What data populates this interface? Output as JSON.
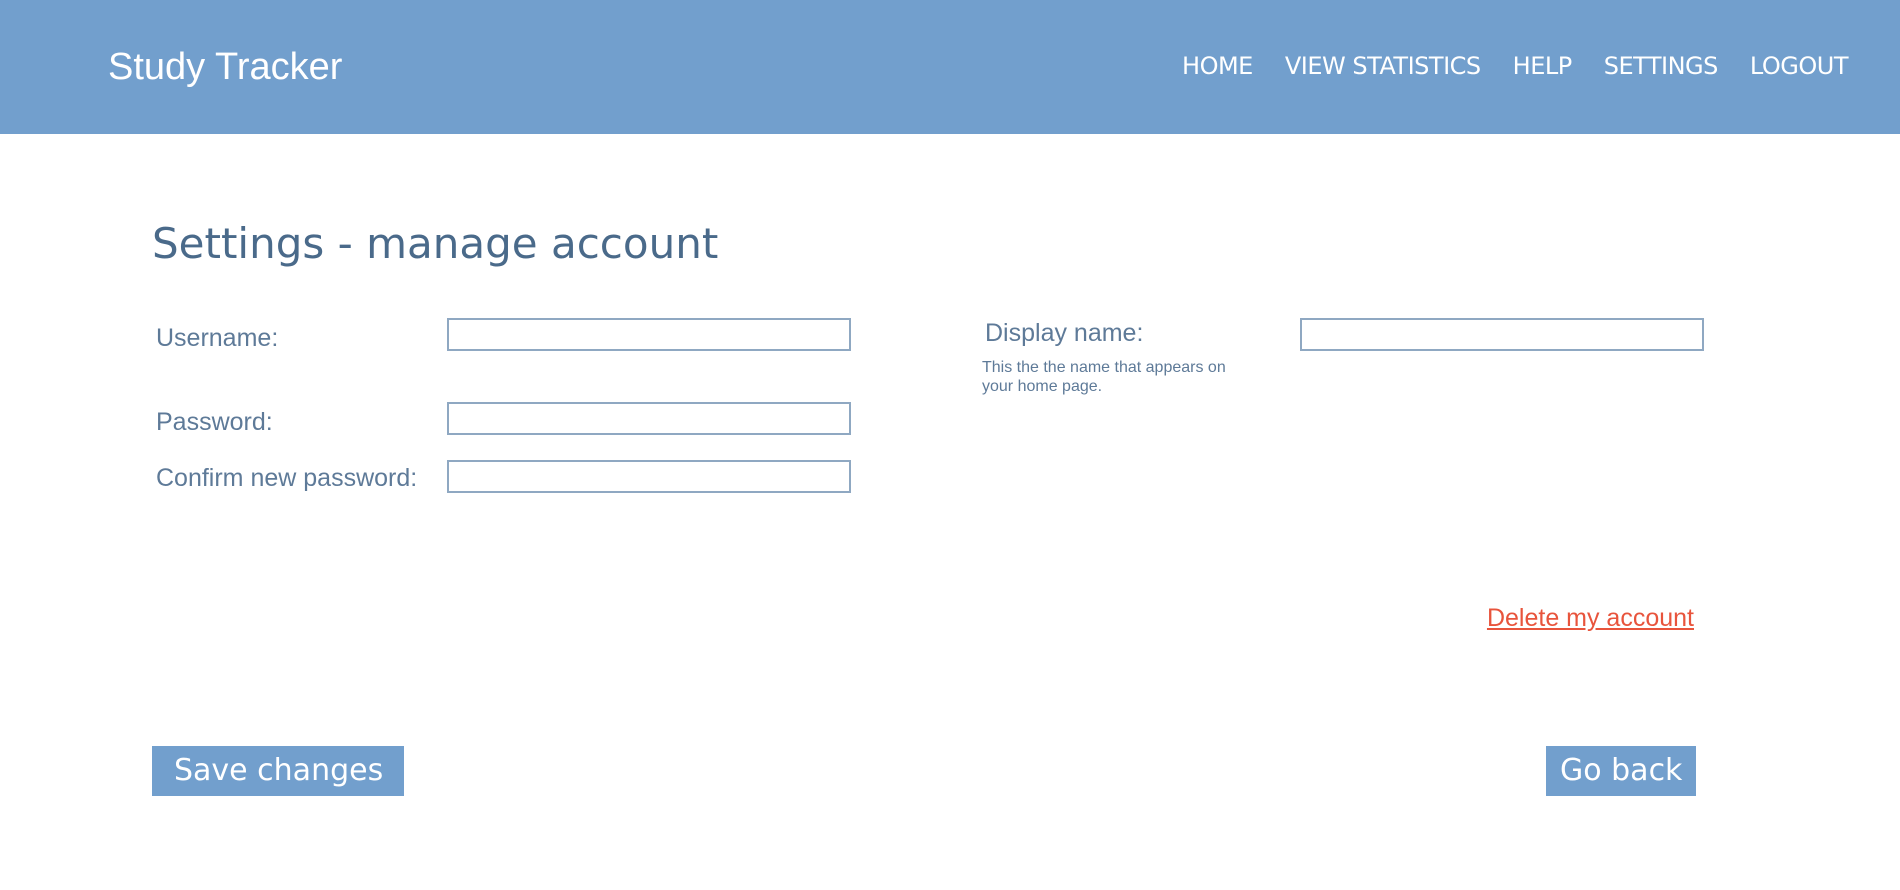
{
  "header": {
    "app_title": "Study Tracker",
    "nav": {
      "home": "HOME",
      "view_statistics": "VIEW STATISTICS",
      "help": "HELP",
      "settings": "SETTINGS",
      "logout": "LOGOUT"
    }
  },
  "main": {
    "page_title": "Settings - manage account",
    "username": {
      "label": "Username:",
      "value": ""
    },
    "password": {
      "label": "Password:",
      "value": ""
    },
    "confirm_password": {
      "label": "Confirm new password:",
      "value": ""
    },
    "display_name": {
      "label": "Display name:",
      "value": "",
      "hint": "This the the name that appears on your home page."
    },
    "delete_link": "Delete my account",
    "save_button": "Save changes",
    "back_button": "Go back"
  },
  "colors": {
    "header_bg": "#729fcd",
    "title_text": "#4a6a8a",
    "label_text": "#5e7a98",
    "danger": "#e8543c",
    "button_bg": "#729fcd"
  }
}
